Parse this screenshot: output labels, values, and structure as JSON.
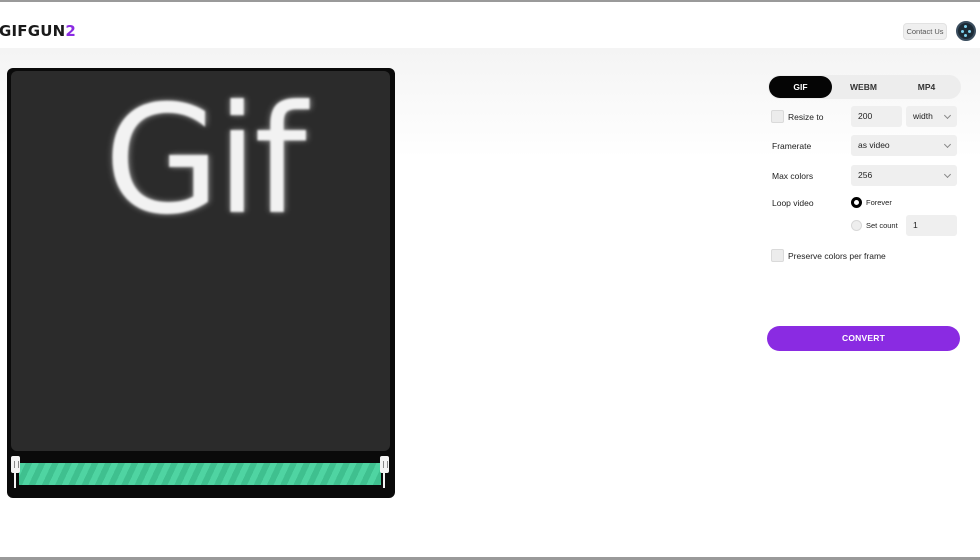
{
  "brand": {
    "logo_main": "GIFGUN",
    "logo_accent": "2",
    "accent_color": "#8a2be2"
  },
  "header": {
    "contact_label": "Contact Us",
    "avatar_icon": "avatar-icon"
  },
  "preview": {
    "overlay_text": "Gif",
    "trim_color": "#4fd4a2"
  },
  "formats": {
    "tabs": [
      "GIF",
      "WEBM",
      "MP4"
    ],
    "active": "GIF"
  },
  "settings": {
    "resize": {
      "label": "Resize to",
      "value": "200",
      "dimension": "width",
      "checked": false
    },
    "framerate": {
      "label": "Framerate",
      "value": "as video"
    },
    "max_colors": {
      "label": "Max colors",
      "value": "256"
    },
    "loop": {
      "label": "Loop video",
      "options": [
        "Forever",
        "Set count"
      ],
      "selected": "Forever",
      "count_value": "1"
    },
    "preserve": {
      "label": "Preserve colors per frame",
      "checked": false
    }
  },
  "convert_label": "CONVERT"
}
